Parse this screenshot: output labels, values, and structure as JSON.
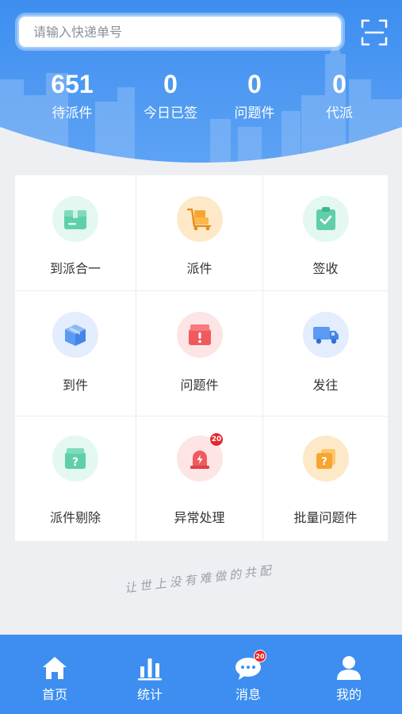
{
  "search": {
    "placeholder": "请输入快递单号"
  },
  "stats": [
    {
      "value": "651",
      "label": "待派件"
    },
    {
      "value": "0",
      "label": "今日已签"
    },
    {
      "value": "0",
      "label": "问题件"
    },
    {
      "value": "0",
      "label": "代派"
    }
  ],
  "grid": [
    {
      "label": "到派合一",
      "icon": "package-box-icon"
    },
    {
      "label": "派件",
      "icon": "delivery-cart-icon"
    },
    {
      "label": "签收",
      "icon": "clipboard-check-icon"
    },
    {
      "label": "到件",
      "icon": "arrival-box-icon"
    },
    {
      "label": "问题件",
      "icon": "problem-box-icon"
    },
    {
      "label": "发往",
      "icon": "truck-icon"
    },
    {
      "label": "派件剔除",
      "icon": "question-box-icon"
    },
    {
      "label": "异常处理",
      "icon": "alarm-light-icon",
      "badge": "20"
    },
    {
      "label": "批量问题件",
      "icon": "batch-question-icon"
    }
  ],
  "slogan": "让世上没有难做的共配",
  "tabbar": [
    {
      "label": "首页",
      "icon": "home-icon",
      "active": true
    },
    {
      "label": "统计",
      "icon": "bar-chart-icon"
    },
    {
      "label": "消息",
      "icon": "chat-bubble-icon",
      "badge": "20"
    },
    {
      "label": "我的",
      "icon": "user-icon"
    }
  ],
  "colors": {
    "primary": "#3d8ef0",
    "green": "#4cc9a2",
    "orange": "#f7a531",
    "blue": "#5a9af3",
    "red": "#f0595e",
    "badge": "#e8262b"
  }
}
